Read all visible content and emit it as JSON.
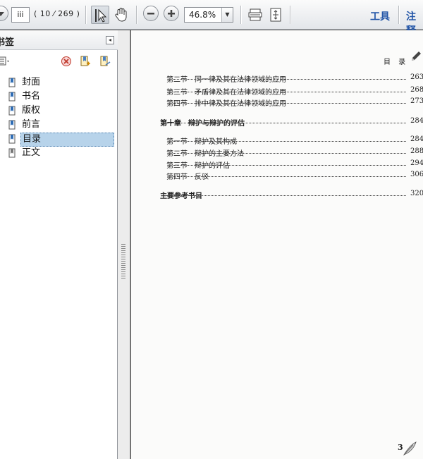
{
  "toolbar": {
    "page_field": "iii",
    "page_count": "( 10 ⁄ 269 )",
    "zoom": "46.8%",
    "tools_label": "工具",
    "comment_label": "注释"
  },
  "sidebar": {
    "title": "书签",
    "items": [
      {
        "label": "封面",
        "selected": false
      },
      {
        "label": "书名",
        "selected": false
      },
      {
        "label": "版权",
        "selected": false
      },
      {
        "label": "前言",
        "selected": false
      },
      {
        "label": "目录",
        "selected": true
      },
      {
        "label": "正文",
        "selected": false
      }
    ]
  },
  "page": {
    "running_head": "目 录",
    "toc": [
      {
        "label": "第二节　同一律及其在法律领域的应用",
        "page": "263"
      },
      {
        "label": "第三节　矛盾律及其在法律领域的应用",
        "page": "268"
      },
      {
        "label": "第四节　排中律及其在法律领域的应用",
        "page": "273"
      },
      {
        "label": "第十章　辩护与辩护的评估",
        "page": "284"
      },
      {
        "label": "第一节　辩护及其构成",
        "page": "284"
      },
      {
        "label": "第二节　辩护的主要方法",
        "page": "288"
      },
      {
        "label": "第三节　辩护的评估",
        "page": "294"
      },
      {
        "label": "第四节　反驳",
        "page": "306"
      },
      {
        "label": "主要参考书目",
        "page": "320"
      }
    ],
    "page_number": "3"
  },
  "colors": {
    "accent": "#2356a8",
    "selection": "#b7d3ea"
  }
}
